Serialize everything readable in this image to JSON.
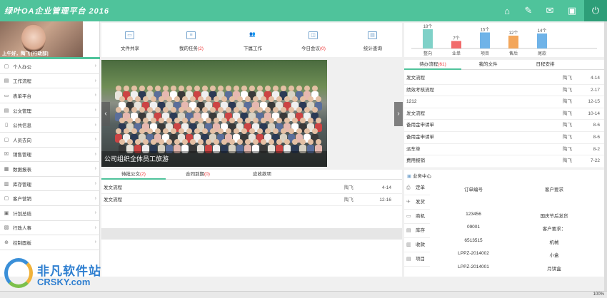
{
  "header": {
    "logo": "绿叶OA企业管理平台 2016",
    "icons": [
      "home-icon",
      "edit-icon",
      "mail-icon",
      "contact-card-icon",
      "power-icon"
    ],
    "accent": "#4fc39b"
  },
  "user": {
    "greeting": "上午好，陶飞 [行政部]"
  },
  "sidebar": {
    "items": [
      {
        "label": "个人办公",
        "icon": "person-icon"
      },
      {
        "label": "工作流程",
        "icon": "workflow-icon"
      },
      {
        "label": "表单平台",
        "icon": "form-icon"
      },
      {
        "label": "公文管理",
        "icon": "document-icon"
      },
      {
        "label": "公共信息",
        "icon": "info-icon"
      },
      {
        "label": "人员去向",
        "icon": "people-icon"
      },
      {
        "label": "销售管理",
        "icon": "sales-icon"
      },
      {
        "label": "数据报表",
        "icon": "report-icon"
      },
      {
        "label": "库存管理",
        "icon": "inventory-icon"
      },
      {
        "label": "客户营销",
        "icon": "customer-icon"
      },
      {
        "label": "计划总结",
        "icon": "plan-icon"
      },
      {
        "label": "行政人事",
        "icon": "hr-icon"
      },
      {
        "label": "控制面板",
        "icon": "settings-icon"
      }
    ]
  },
  "quick": {
    "items": [
      {
        "label": "文件共享",
        "count": ""
      },
      {
        "label": "我的任务",
        "count": "(2)"
      },
      {
        "label": "下属工作",
        "count": ""
      },
      {
        "label": "今日会议",
        "count": "(0)"
      },
      {
        "label": "统计查询",
        "count": ""
      }
    ]
  },
  "chart_data": {
    "type": "bar",
    "categories": [
      "整向",
      "业单",
      "项目",
      "售后",
      "尾款"
    ],
    "values": [
      18,
      7,
      15,
      12,
      14
    ],
    "labels": [
      "18个",
      "7个",
      "15个",
      "12个",
      "14个"
    ],
    "colors": [
      "#7fd1c8",
      "#f26b6b",
      "#6fb3e8",
      "#f3a65a",
      "#6fb3e8"
    ]
  },
  "slider": {
    "caption": "公司组织全体员工旅游"
  },
  "tasks": {
    "tabs": [
      {
        "label": "待办流程",
        "count": "(61)"
      },
      {
        "label": "我的文件",
        "count": ""
      },
      {
        "label": "日程安排",
        "count": ""
      }
    ],
    "rows": [
      {
        "title": "发文流程",
        "user": "陶飞",
        "date": "4-14"
      },
      {
        "title": "绩效考核流程",
        "user": "陶飞",
        "date": "2-17"
      },
      {
        "title": "1212",
        "user": "陶飞",
        "date": "12-15"
      },
      {
        "title": "发文流程",
        "user": "陶飞",
        "date": "10-14"
      },
      {
        "title": "备用金申请单",
        "user": "陶飞",
        "date": "8-6"
      },
      {
        "title": "备用金申请单",
        "user": "陶飞",
        "date": "8-6"
      },
      {
        "title": "派车单",
        "user": "陶飞",
        "date": "8-2"
      },
      {
        "title": "费用报销",
        "user": "陶飞",
        "date": "7-22"
      }
    ]
  },
  "docs": {
    "tabs": [
      {
        "label": "待批公文",
        "count": "(2)"
      },
      {
        "label": "合同到期",
        "count": "(0)"
      },
      {
        "label": "应收款项",
        "count": ""
      }
    ],
    "rows": [
      {
        "title": "发文流程",
        "user": "陶飞",
        "date": "4-14"
      },
      {
        "title": "发文流程",
        "user": "陶飞",
        "date": "12-16"
      }
    ]
  },
  "biz": {
    "title": "业务中心",
    "side": [
      {
        "label": "定单",
        "icon": "order-icon"
      },
      {
        "label": "发货",
        "icon": "ship-icon"
      },
      {
        "label": "商机",
        "icon": "opportunity-icon"
      },
      {
        "label": "库存",
        "icon": "stock-icon"
      },
      {
        "label": "收款",
        "icon": "payment-icon"
      },
      {
        "label": "项目",
        "icon": "project-icon"
      }
    ],
    "col1_head": "订单编号",
    "col2_head": "客户要求",
    "rows": [
      {
        "a": "",
        "b": ""
      },
      {
        "a": "123456",
        "b": "国庆节后发货"
      },
      {
        "a": "09001",
        "b": "客户要求："
      },
      {
        "a": "6513515",
        "b": "机械"
      },
      {
        "a": "LPPZ-2014002",
        "b": "小盒"
      },
      {
        "a": "LPPZ-2014001",
        "b": "月饼盒"
      }
    ]
  },
  "watermark": {
    "cn": "非凡软件站",
    "en": "CRSKY.com"
  },
  "statusbar": {
    "zoom": "100%"
  }
}
